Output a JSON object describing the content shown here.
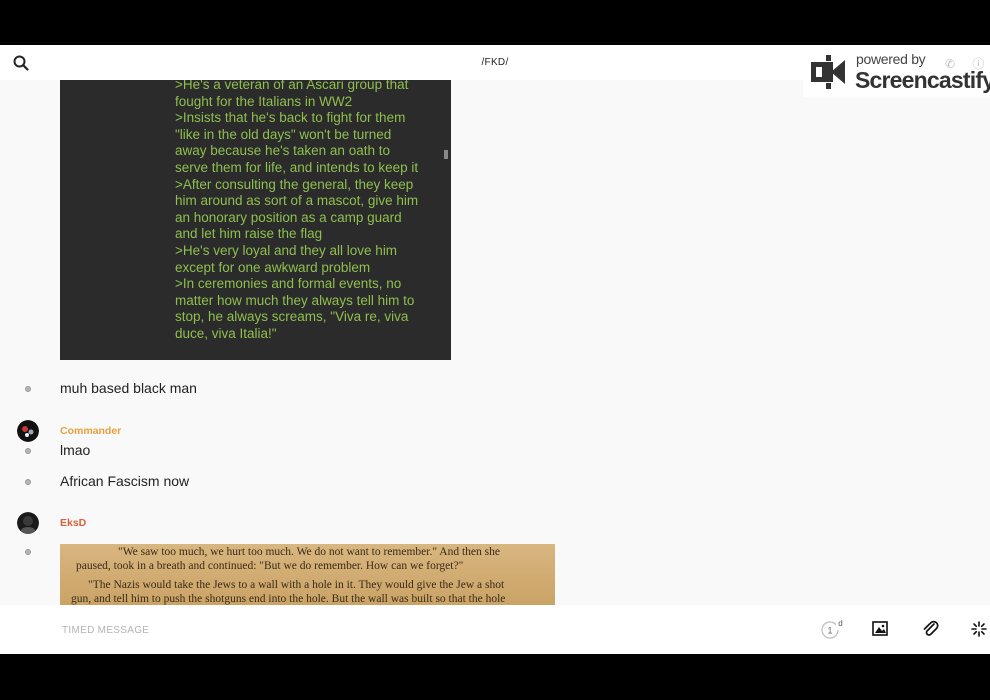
{
  "header": {
    "title": "/FKD/"
  },
  "watermark": {
    "powered_by": "powered by",
    "brand": "Screencastify"
  },
  "messages": [
    {
      "type": "image",
      "lines": [
        ">He's a veteran of an Ascari group that",
        "fought for the Italians in WW2",
        ">Insists that he's back to fight for them",
        "\"like in the old days\" won't be turned",
        "away because he's taken an oath to",
        "serve them for life, and intends to keep it",
        ">After consulting the general, they keep",
        "him around as sort of a mascot, give him",
        "an honorary position as a camp guard",
        "and let him raise the flag",
        ">He's very loyal and they all love him",
        "except for one awkward problem",
        ">In ceremonies and formal events, no",
        "matter how much they always tell him to",
        "stop, he always screams, \"Viva re, viva",
        "duce, viva Italia!\""
      ]
    },
    {
      "type": "text",
      "text": "muh based black man"
    },
    {
      "type": "author",
      "name": "Commander",
      "color": "#e8a03c"
    },
    {
      "type": "text",
      "text": "lmao"
    },
    {
      "type": "text",
      "text": "African Fascism now"
    },
    {
      "type": "author",
      "name": "EksD",
      "color": "#d9603b"
    },
    {
      "type": "image",
      "lines": [
        "\"We saw too much, we hurt too much. We do not want to remember.\" And then she",
        "paused, took in a breath and continued: \"But we do remember. How can we forget?\"",
        "\"The Nazis would take the Jews to a wall with a hole in it. They would give the Jew a shot",
        "gun, and tell him to push the shotguns end into the hole. But the wall was built so that the hole"
      ]
    }
  ],
  "composer": {
    "placeholder": "TIMED MESSAGE",
    "timer_value": "1",
    "timer_unit": "d"
  }
}
